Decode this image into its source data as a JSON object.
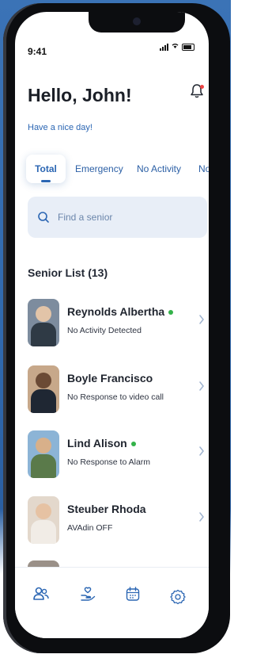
{
  "status_bar": {
    "time": "9:41"
  },
  "header": {
    "greeting": "Hello, John!",
    "subtitle": "Have a nice day!"
  },
  "tabs": [
    {
      "label": "Total",
      "active": true
    },
    {
      "label": "Emergency"
    },
    {
      "label": "No Activity"
    },
    {
      "label": "No"
    }
  ],
  "search": {
    "placeholder": "Find a senior"
  },
  "senior_list": {
    "title": "Senior List (13)",
    "items": [
      {
        "name": "Reynolds Albertha",
        "detail": "No Activity Detected",
        "online": true
      },
      {
        "name": "Boyle Francisco",
        "detail": "No Response to video call",
        "online": false
      },
      {
        "name": "Lind Alison",
        "detail": "No Response to Alarm",
        "online": true
      },
      {
        "name": "Steuber Rhoda",
        "detail": "AVAdin OFF",
        "online": false
      }
    ]
  },
  "bottom_nav": {
    "items": [
      {
        "icon": "seniors-icon",
        "active": true
      },
      {
        "icon": "care-hand-icon"
      },
      {
        "icon": "calendar-icon"
      },
      {
        "icon": "settings-gear-icon"
      }
    ]
  },
  "colors": {
    "accent": "#2b66b3",
    "online_green": "#33b249",
    "notification_red": "#e44444",
    "search_bg": "#e8eef7",
    "background_blue": "#3b73b6"
  }
}
